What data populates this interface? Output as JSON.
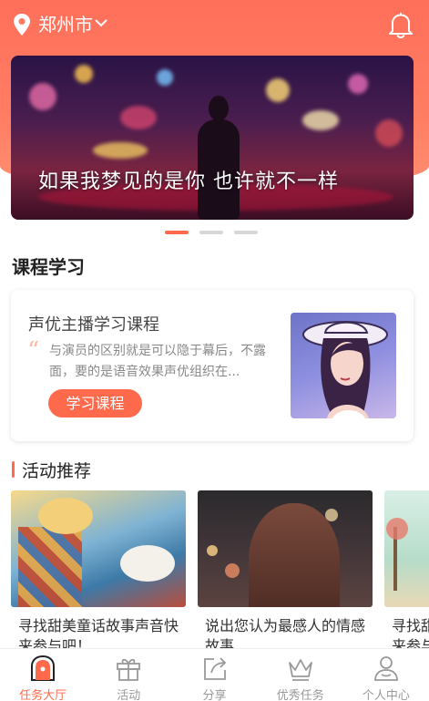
{
  "header": {
    "city": "郑州市"
  },
  "banner": {
    "text": "如果我梦见的是你  也许就不一样"
  },
  "course_section": {
    "title": "课程学习"
  },
  "course": {
    "title": "声优主播学习课程",
    "desc": "与演员的区别就是可以隐于幕后，不露面，要的是语音效果声优组织在...",
    "button": "学习课程"
  },
  "activity_section": {
    "title": "活动推荐"
  },
  "activities": [
    {
      "text": "寻找甜美童话故事声音快来参与吧！"
    },
    {
      "text": "说出您认为最感人的情感故事"
    },
    {
      "text": "寻找甜美童话故事声音快来参与吧！"
    }
  ],
  "tabs": [
    {
      "label": "任务大厅",
      "icon": "task-hall-icon"
    },
    {
      "label": "活动",
      "icon": "gift-icon"
    },
    {
      "label": "分享",
      "icon": "share-icon"
    },
    {
      "label": "优秀任务",
      "icon": "crown-icon"
    },
    {
      "label": "个人中心",
      "icon": "person-icon"
    }
  ],
  "colors": {
    "accent": "#ff6a4d",
    "header_bg": "#ff7a60"
  }
}
